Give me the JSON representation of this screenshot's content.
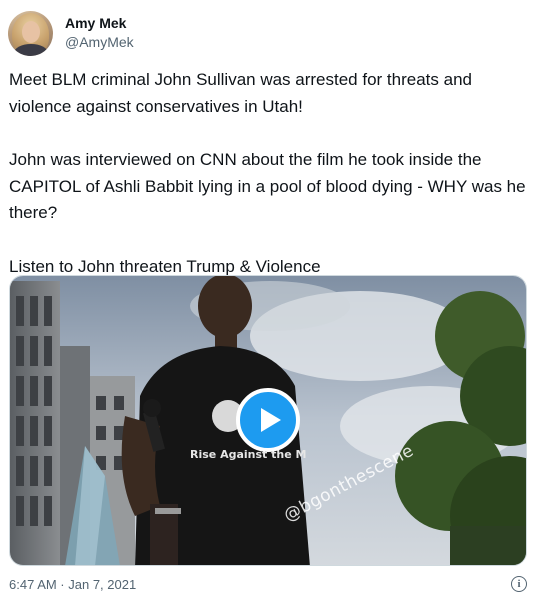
{
  "author": {
    "display_name": "Amy Mek",
    "handle": "@AmyMek"
  },
  "tweet": {
    "paragraphs": [
      "Meet BLM criminal John Sullivan was arrested for threats and violence against conservatives in Utah!",
      "John was interviewed on CNN about the film he took inside the CAPITOL of Ashli Babbit lying in a pool of blood dying - WHY was he there?",
      "Listen to John threaten Trump & Violence"
    ],
    "timestamp": "6:47 AM · Jan 7, 2021"
  },
  "media": {
    "type": "video",
    "watermark": "@bgonthescene",
    "shirt_text": "Rise Against the M",
    "play_icon": "play-icon"
  },
  "icons": {
    "info": "info-icon",
    "info_glyph": "i"
  },
  "colors": {
    "accent": "#1d9bf0",
    "text_primary": "#0f1419",
    "text_secondary": "#536471",
    "border": "#cfd9de"
  }
}
